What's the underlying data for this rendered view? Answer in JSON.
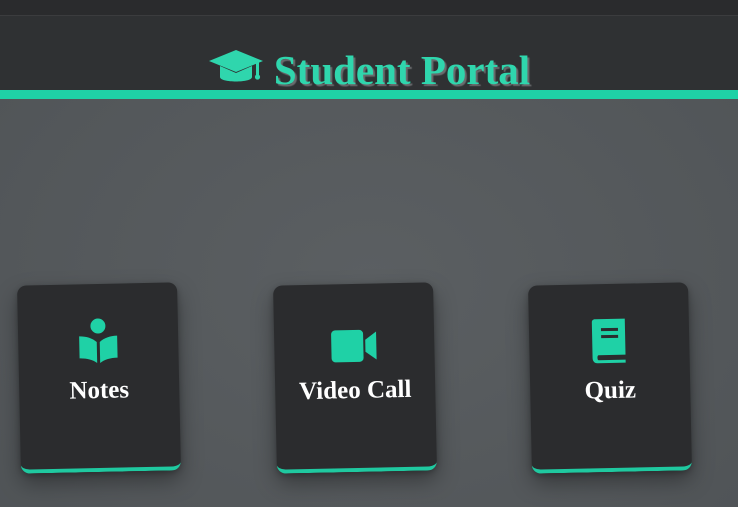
{
  "header": {
    "title": "Student Portal",
    "icon": "graduation-cap-icon"
  },
  "cards": [
    {
      "label": "Notes",
      "icon": "reading-person-icon"
    },
    {
      "label": "Video Call",
      "icon": "video-camera-icon"
    },
    {
      "label": "Quiz",
      "icon": "book-icon"
    }
  ],
  "colors": {
    "accent": "#1fd1a6",
    "header_bg": "#2f3133",
    "page_bg": "#575b5e",
    "card_bg": "#2b2c2e",
    "card_text": "#ffffff"
  }
}
